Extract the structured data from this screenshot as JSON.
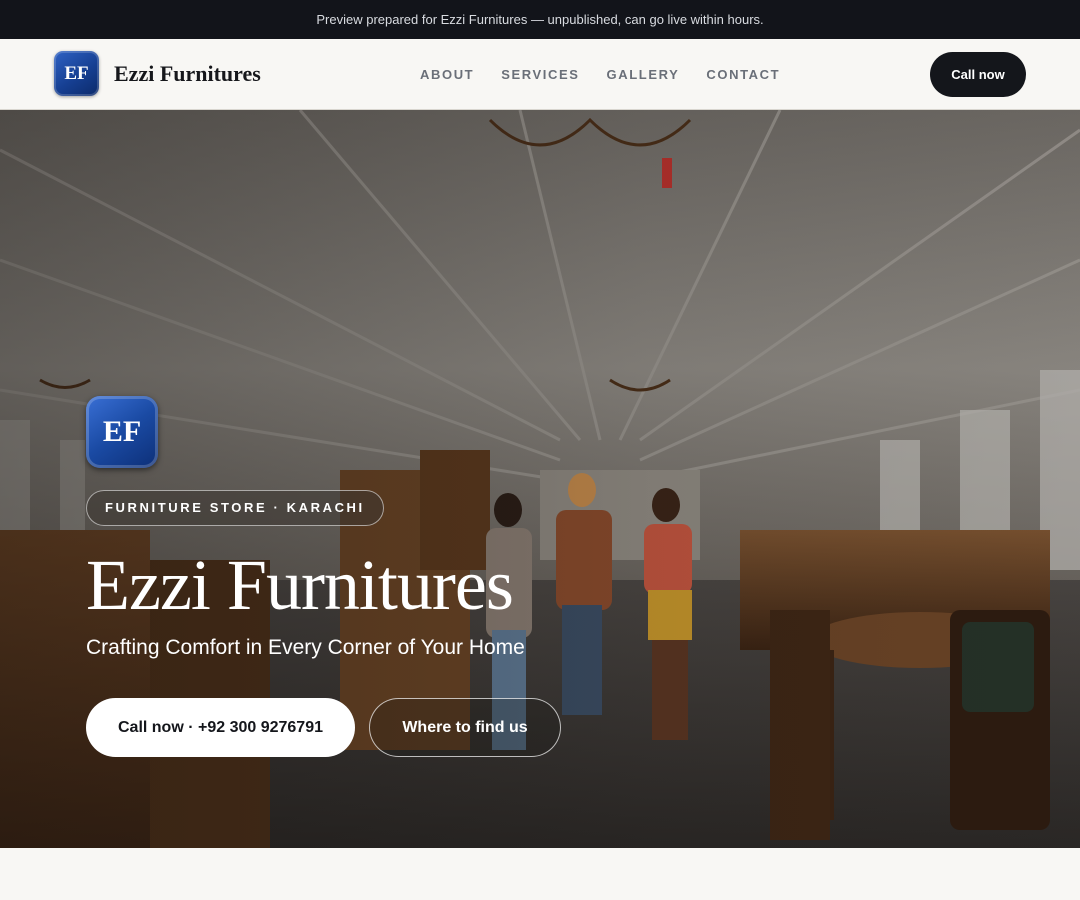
{
  "banner": {
    "text": "Preview prepared for Ezzi Furnitures — unpublished, can go live within hours."
  },
  "header": {
    "logo_initials": "EF",
    "brand_name": "Ezzi Furnitures",
    "nav": [
      {
        "label": "ABOUT"
      },
      {
        "label": "SERVICES"
      },
      {
        "label": "GALLERY"
      },
      {
        "label": "CONTACT"
      }
    ],
    "cta_label": "Call now"
  },
  "hero": {
    "logo_initials": "EF",
    "badge": "FURNITURE STORE · KARACHI",
    "title": "Ezzi Furnitures",
    "subtitle": "Crafting Comfort in Every Corner of Your Home",
    "primary_button": "Call now · +92 300 9276791",
    "secondary_button": "Where to find us"
  },
  "colors": {
    "banner_bg": "#12141a",
    "dark_button": "#14161b",
    "logo_blue": "#1a4aa3",
    "page_bg": "#f8f7f4"
  }
}
